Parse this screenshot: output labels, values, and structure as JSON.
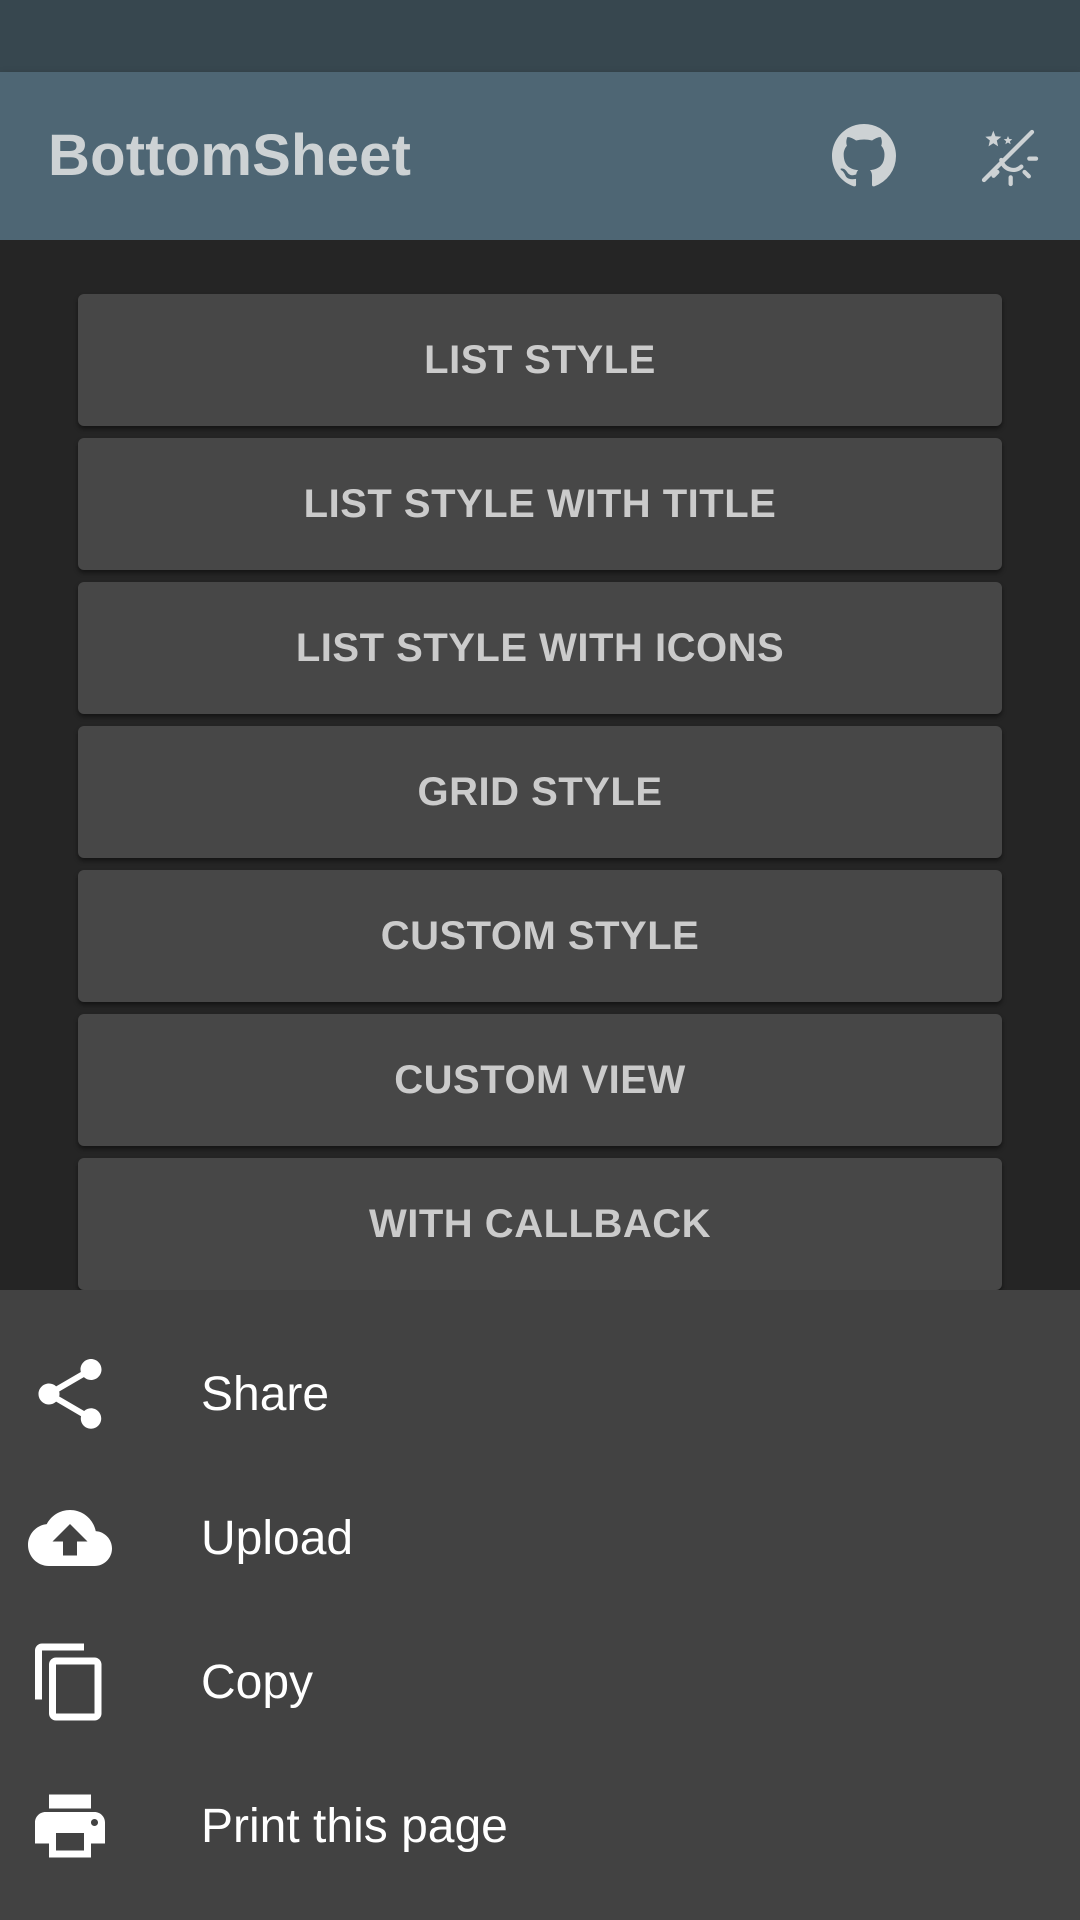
{
  "app_bar": {
    "title": "BottomSheet",
    "actions": [
      {
        "icon": "github-icon"
      },
      {
        "icon": "theme-toggle-icon"
      }
    ]
  },
  "buttons": [
    {
      "label": "LIST STYLE"
    },
    {
      "label": "LIST STYLE WITH TITLE"
    },
    {
      "label": "LIST STYLE WITH ICONS"
    },
    {
      "label": "GRID STYLE"
    },
    {
      "label": "CUSTOM STYLE"
    },
    {
      "label": "CUSTOM VIEW"
    },
    {
      "label": "WITH CALLBACK"
    }
  ],
  "bottom_sheet": {
    "items": [
      {
        "label": "Share",
        "icon": "share-icon"
      },
      {
        "label": "Upload",
        "icon": "cloud-upload-icon"
      },
      {
        "label": "Copy",
        "icon": "copy-icon"
      },
      {
        "label": "Print this page",
        "icon": "print-icon"
      }
    ]
  },
  "colors": {
    "status_bar": "#37474f",
    "app_bar": "#4e6674",
    "background": "#252525",
    "button": "#474747",
    "sheet": "#424242"
  }
}
